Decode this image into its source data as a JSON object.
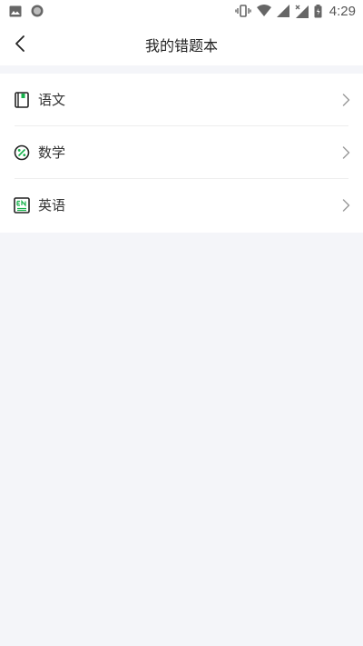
{
  "status_bar": {
    "time": "4:29",
    "icons": [
      "image-icon",
      "record-icon",
      "vibrate-icon",
      "wifi-icon",
      "signal-icon",
      "signal-no-service-icon",
      "battery-icon"
    ]
  },
  "header": {
    "title": "我的错题本",
    "back_icon": "chevron-left-icon"
  },
  "subjects": [
    {
      "label": "语文",
      "icon": "book-icon"
    },
    {
      "label": "数学",
      "icon": "percent-icon"
    },
    {
      "label": "英语",
      "icon": "en-icon"
    }
  ],
  "colors": {
    "accent": "#16b24b",
    "background": "#f4f5f9",
    "surface": "#ffffff",
    "text": "#333333"
  }
}
